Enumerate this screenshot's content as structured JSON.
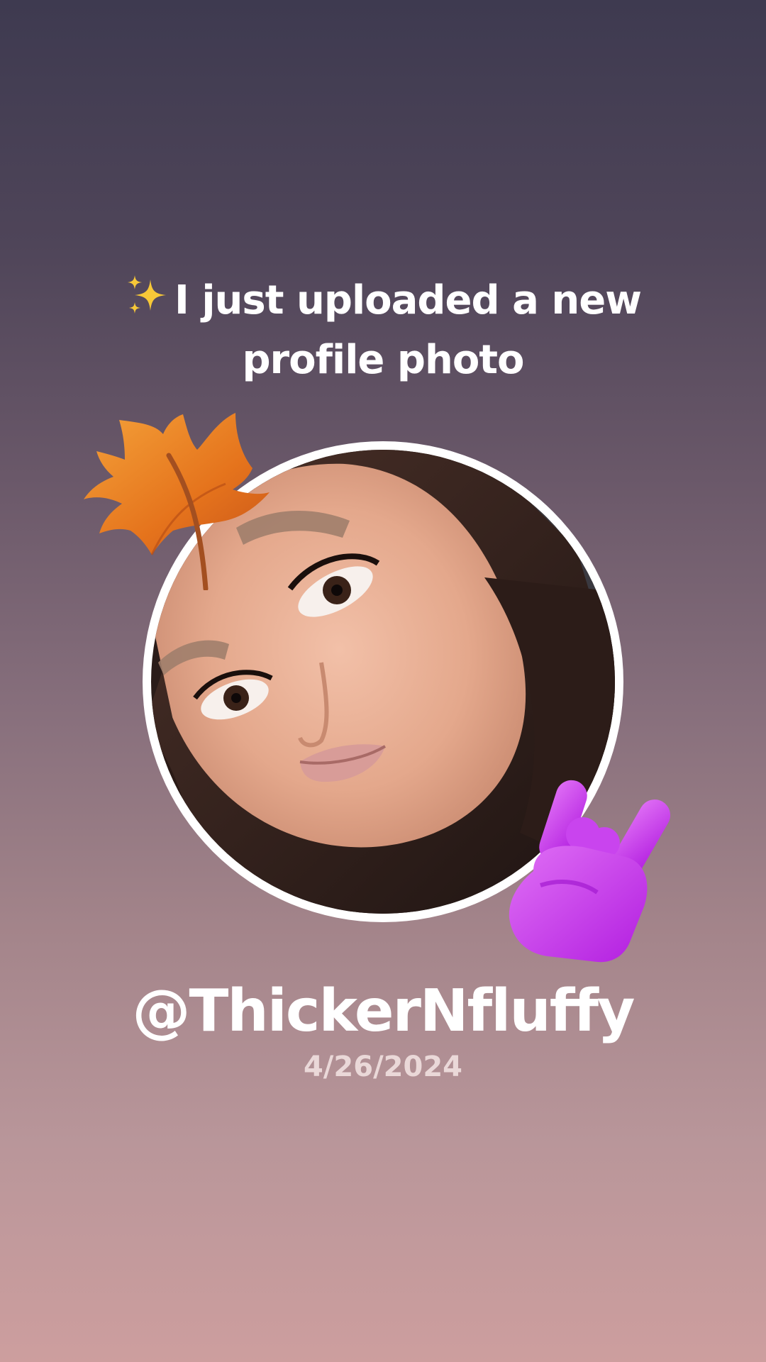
{
  "headline": {
    "icon": "sparkles-icon",
    "text": "I just uploaded a new profile photo"
  },
  "profile": {
    "username": "@ThickerNfluffy",
    "date": "4/26/2024"
  },
  "stickers": [
    "maple-leaf-icon",
    "rock-on-hand-icon"
  ],
  "colors": {
    "background_top": "#3e3a50",
    "background_bottom": "#cd9e9e",
    "ring": "#ffffff",
    "text": "#ffffff",
    "date": "#ead8d8",
    "leaf": "#e8861a",
    "hand": "#d53ef0"
  }
}
